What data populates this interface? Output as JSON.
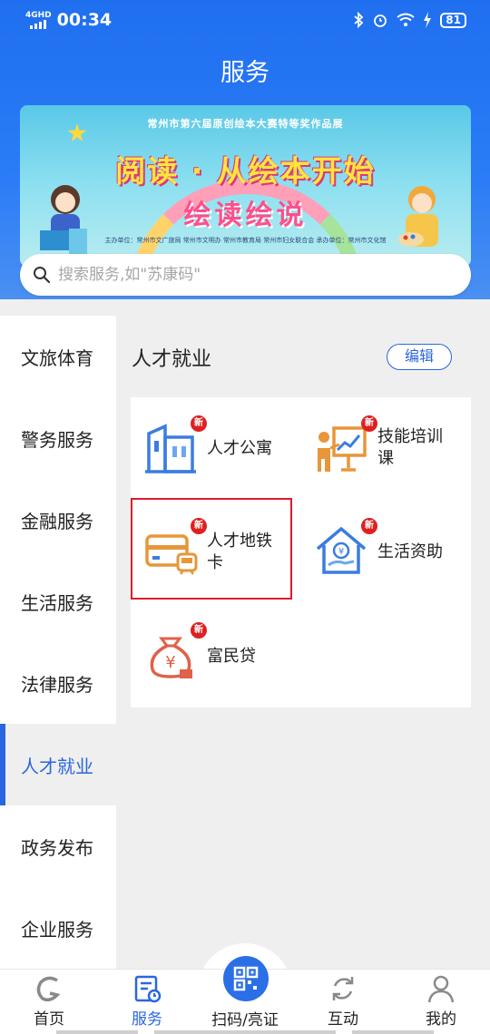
{
  "status_bar": {
    "signal_label": "4GHD",
    "time": "00:34",
    "battery": "81"
  },
  "header": {
    "title": "服务"
  },
  "banner": {
    "top_text": "常州市第六届原创绘本大赛特等奖作品展",
    "main_text": "阅读 · 从绘本开始",
    "sub_text": "绘读绘说",
    "org_text": "主办单位：常州市文广旅局 常州市文明办 常州市教育局 常州市妇女联合会  承办单位：常州市文化馆"
  },
  "search": {
    "placeholder": "搜索服务,如\"苏康码\""
  },
  "sidebar": {
    "items": [
      {
        "label": "文旅体育"
      },
      {
        "label": "警务服务"
      },
      {
        "label": "金融服务"
      },
      {
        "label": "生活服务"
      },
      {
        "label": "法律服务"
      },
      {
        "label": "人才就业",
        "active": true
      },
      {
        "label": "政务发布"
      },
      {
        "label": "企业服务"
      }
    ]
  },
  "section": {
    "title": "人才就业",
    "edit_label": "编辑"
  },
  "services": [
    {
      "label": "人才公寓",
      "badge": "新",
      "icon": "apartment-building-icon"
    },
    {
      "label": "技能培训课",
      "badge": "新",
      "icon": "training-board-icon"
    },
    {
      "label": "人才地铁卡",
      "badge": "新",
      "icon": "metro-card-icon"
    },
    {
      "label": "生活资助",
      "badge": "新",
      "icon": "living-subsidy-icon"
    },
    {
      "label": "富民贷",
      "badge": "新",
      "icon": "money-bag-icon"
    }
  ],
  "bottom_nav": [
    {
      "label": "首页",
      "icon": "home-logo-icon"
    },
    {
      "label": "服务",
      "icon": "service-doc-icon",
      "active": true
    },
    {
      "label": "扫码/亮证",
      "icon": "qr-scan-icon"
    },
    {
      "label": "互动",
      "icon": "refresh-icon"
    },
    {
      "label": "我的",
      "icon": "person-icon"
    }
  ],
  "colors": {
    "primary": "#2a66e0",
    "header": "#1f6ff0",
    "badge": "#e02020",
    "highlight": "#e0182d",
    "icon_blue": "#3a7de0",
    "icon_orange": "#e7963a"
  }
}
